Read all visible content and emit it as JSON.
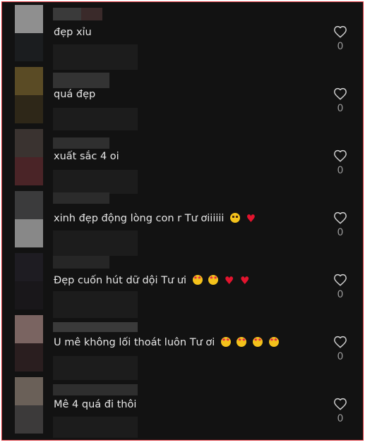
{
  "comments": [
    {
      "text": "đẹp xỉu",
      "likes": "0",
      "avatar_top": "#8f8f8f",
      "avatar_bottom": "#1b1d1f",
      "emojis": []
    },
    {
      "text": "quá đẹp",
      "likes": "0",
      "avatar_top": "#5a4b25",
      "avatar_bottom": "#2e2718",
      "emojis": []
    },
    {
      "text": "xuất sắc 4 oi",
      "likes": "0",
      "avatar_top": "#3a3330",
      "avatar_bottom": "#4a2427",
      "emojis": []
    },
    {
      "text": "xinh đẹp động lòng con r Tư ơiiiiii",
      "likes": "0",
      "avatar_top": "#3b3b3c",
      "avatar_bottom": "#888888",
      "emojis": [
        "pleading-face",
        "red-heart"
      ]
    },
    {
      "text": "Đẹp cuốn hút dữ dội Tư ưi",
      "likes": "0",
      "avatar_top": "#1e1c22",
      "avatar_bottom": "#19171a",
      "emojis": [
        "star-struck",
        "star-struck",
        "red-heart",
        "red-heart"
      ]
    },
    {
      "text": "U mê không lối thoát luôn Tư ơi",
      "likes": "0",
      "avatar_top": "#7a6461",
      "avatar_bottom": "#2a1e1f",
      "emojis": [
        "star-struck",
        "star-struck",
        "star-struck",
        "star-struck"
      ]
    },
    {
      "text": "Mê 4 quá đi thôi",
      "likes": "0",
      "avatar_top": "#6a6058",
      "avatar_bottom": "#3c3a3a",
      "emojis": []
    }
  ],
  "colors": {
    "border": "#d9343b",
    "background": "#121212",
    "text": "#e6e6e6",
    "count": "#9a9a9a"
  },
  "icons": {
    "like": "heart-outline-icon"
  }
}
